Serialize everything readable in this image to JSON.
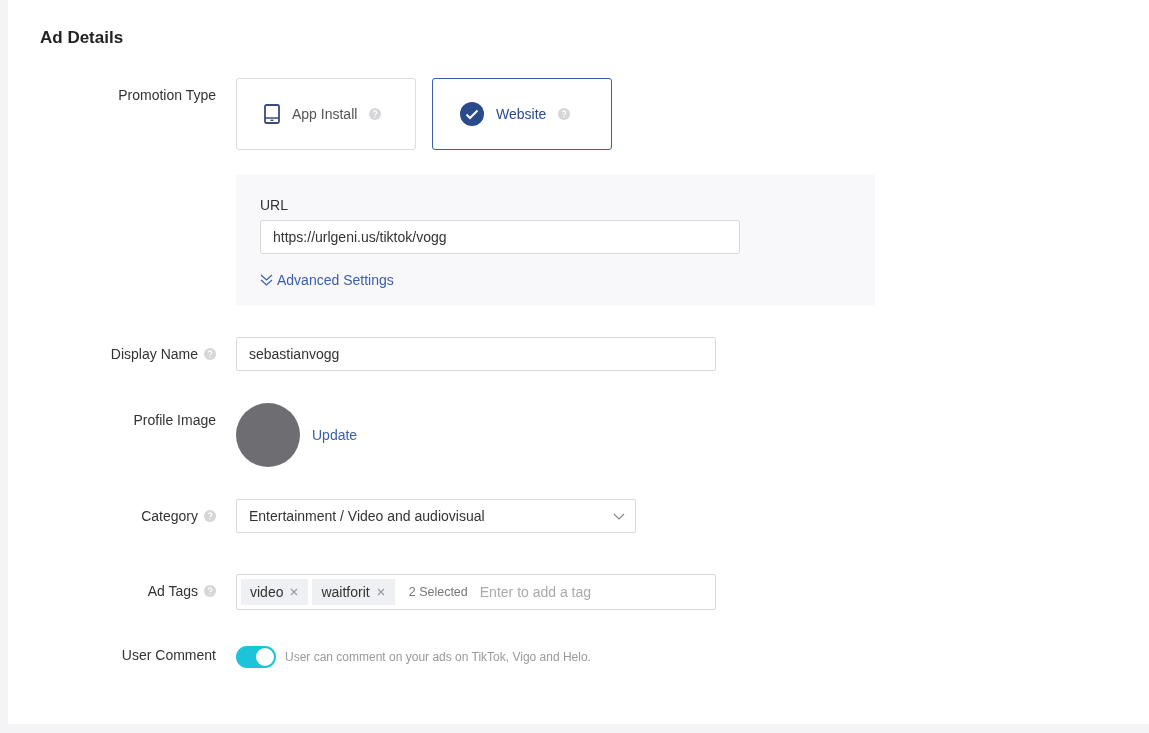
{
  "section_title": "Ad Details",
  "promotion_type": {
    "label": "Promotion Type",
    "options": [
      {
        "label": "App Install",
        "help": true,
        "selected": false
      },
      {
        "label": "Website",
        "help": true,
        "selected": true
      }
    ]
  },
  "url": {
    "label": "URL",
    "value": "https://urlgeni.us/tiktok/vogg",
    "advanced_link": "Advanced Settings"
  },
  "display_name": {
    "label": "Display Name",
    "help": true,
    "value": "sebastianvogg"
  },
  "profile_image": {
    "label": "Profile Image",
    "action": "Update"
  },
  "category": {
    "label": "Category",
    "help": true,
    "value": "Entertainment / Video and audiovisual"
  },
  "ad_tags": {
    "label": "Ad Tags",
    "help": true,
    "tags": [
      "video",
      "waitforit"
    ],
    "count": "2 Selected",
    "placeholder": "Enter to add a tag"
  },
  "user_comment": {
    "label": "User Comment",
    "on": true,
    "hint": "User can comment on your ads on TikTok, Vigo and Helo."
  }
}
